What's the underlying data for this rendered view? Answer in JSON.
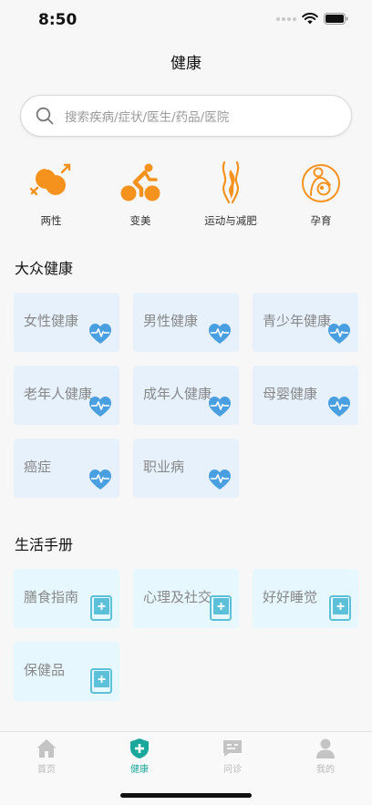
{
  "status": {
    "time": "8:50"
  },
  "nav": {
    "title": "健康"
  },
  "search": {
    "placeholder": "搜索疾病/症状/医生/药品/医院"
  },
  "categories": [
    {
      "label": "两性",
      "icon": "gender-icon"
    },
    {
      "label": "变美",
      "icon": "cycling-icon"
    },
    {
      "label": "运动与减肥",
      "icon": "body-slim-icon"
    },
    {
      "label": "孕育",
      "icon": "pregnancy-icon"
    }
  ],
  "public_health": {
    "title": "大众健康",
    "items": [
      "女性健康",
      "男性健康",
      "青少年健康",
      "老年人健康",
      "成年人健康",
      "母婴健康",
      "癌症",
      "职业病"
    ]
  },
  "life_manual": {
    "title": "生活手册",
    "items": [
      "膳食指南",
      "心理及社交",
      "好好睡觉",
      "保健品"
    ]
  },
  "tabs": [
    {
      "label": "首页",
      "active": false
    },
    {
      "label": "健康",
      "active": true
    },
    {
      "label": "问诊",
      "active": false
    },
    {
      "label": "我的",
      "active": false
    }
  ],
  "colors": {
    "accent": "#1aa79b",
    "orange": "#f5921e",
    "heart": "#4a9fe0",
    "book": "#5cc0d8"
  }
}
